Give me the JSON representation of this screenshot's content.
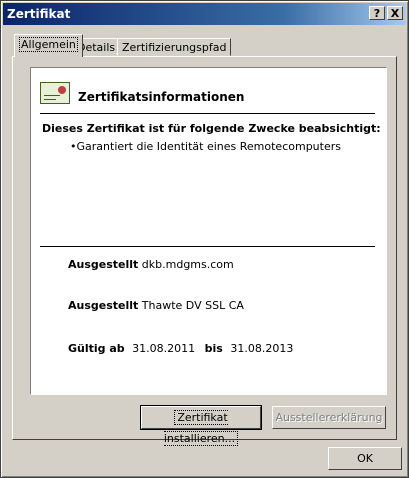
{
  "window": {
    "title": "Zertifikat"
  },
  "title_buttons": {
    "help": "?",
    "close": "X"
  },
  "tabs": [
    {
      "label": "Allgemein"
    },
    {
      "label": "Details"
    },
    {
      "label": "Zertifizierungspfad"
    }
  ],
  "info": {
    "heading": "Zertifikatsinformationen",
    "purpose_title": "Dieses Zertifikat ist für folgende Zwecke beabsichtigt:",
    "purpose_items": [
      "Garantiert die Identität eines Remotecomputers"
    ]
  },
  "issued_to": {
    "label": "Ausgestellt",
    "value": "dkb.mdgms.com"
  },
  "issued_by": {
    "label": "Ausgestellt",
    "value": "Thawte DV SSL CA"
  },
  "validity": {
    "from_label": "Gültig ab",
    "from": "31.08.2011",
    "to_label": "bis",
    "to": "31.08.2013"
  },
  "buttons": {
    "install": "Zertifikat installieren...",
    "issuer_statement": "Ausstellererklärung",
    "ok": "OK"
  }
}
